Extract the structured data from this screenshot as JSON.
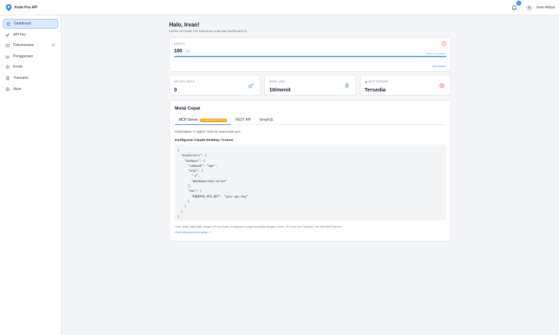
{
  "app": {
    "name": "Kode Pos API",
    "brand_color": "#3b82f6"
  },
  "topbar": {
    "notification_count": "2",
    "user_initials": "IA",
    "user_name": "Irvan Aditya"
  },
  "sidebar": {
    "items": [
      {
        "label": "Dashboard",
        "icon": "home-icon",
        "active": true
      },
      {
        "label": "API Key",
        "icon": "key-icon"
      },
      {
        "label": "Dokumentasi",
        "icon": "book-icon",
        "external": true
      },
      {
        "label": "Penggunaan",
        "icon": "chart-icon"
      },
      {
        "label": "Kredit",
        "icon": "coin-icon"
      },
      {
        "label": "Transaksi",
        "icon": "receipt-icon"
      },
      {
        "label": "Akun",
        "icon": "user-icon"
      }
    ]
  },
  "header": {
    "title": "Halo, Irvan!",
    "subtitle": "Kelola API Kode Pos Indonesia Anda dari dashboard ini."
  },
  "credit": {
    "label": "KREDIT",
    "value": "100",
    "total": "/ 100",
    "fraction": 1.0,
    "status": "Belum terpakai",
    "buy_label": "Beli kredit"
  },
  "stats": [
    {
      "label": "API KEY AKTIF",
      "value": "0",
      "icon": "key-icon"
    },
    {
      "label": "RATE LIMIT",
      "value": "10/menit",
      "icon": "lightning-icon"
    },
    {
      "label": "MCP SERVER",
      "value": "Tersedia",
      "icon": "robot-icon"
    }
  ],
  "quick_start": {
    "title": "Mulai Cepat",
    "tabs": [
      {
        "label": "MCP Server",
        "badge": "DIREKOMENDASIKAN",
        "active": true
      },
      {
        "label": "REST API"
      },
      {
        "label": "GraphQL"
      }
    ],
    "description": "Hubungkan AI agent Anda ke data kode pos.",
    "config_title": "Konfigurasi Claude Desktop / Cursor",
    "code": "{\n  \"mcpServers\": {\n    \"kodepos\": {\n      \"command\": \"npx\",\n      \"args\": [\n        \"-y\",\n        \"@kodepos/mcp-server\"\n      ],\n      \"env\": {\n        \"KODEPOS_API_KEY\": \"your-api-key\"\n      }\n    }\n  }\n}",
    "note_prefix": "Ganti",
    "note_code": "your-api-key",
    "note_suffix": "dengan API key Anda. Konfigurasi ini juga kompatibel dengan Cursor, VS Code (via Continue), dan klien MCP lainnya.",
    "doc_link": "Lihat dokumentasi lengkap ↗"
  }
}
